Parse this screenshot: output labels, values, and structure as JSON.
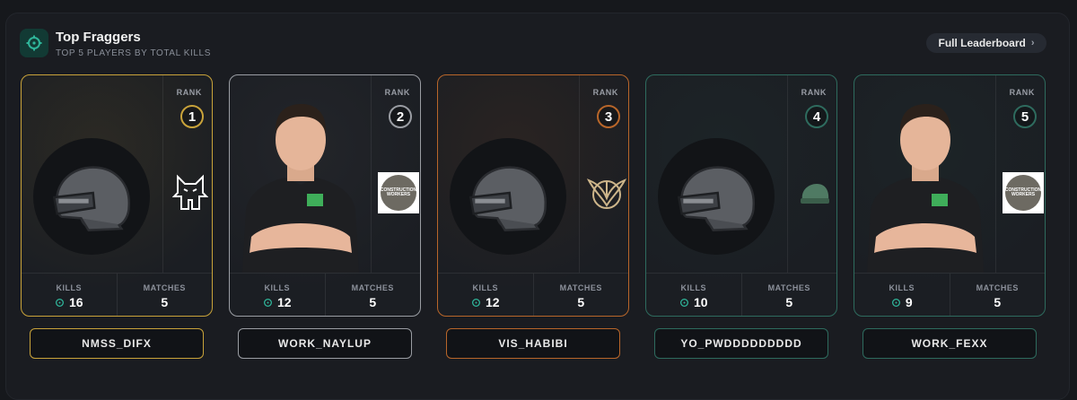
{
  "header": {
    "title": "Top Fraggers",
    "subtitle": "TOP 5 PLAYERS BY TOTAL KILLS",
    "leaderboard_button": "Full Leaderboard"
  },
  "labels": {
    "rank": "RANK",
    "kills": "KILLS",
    "matches": "MATCHES"
  },
  "players": [
    {
      "rank": "1",
      "name": "NMSS_DIFX",
      "kills": "16",
      "matches": "5",
      "accent": "#c9a33a"
    },
    {
      "rank": "2",
      "name": "WORK_NAYLUP",
      "kills": "12",
      "matches": "5",
      "accent": "#9a9da3"
    },
    {
      "rank": "3",
      "name": "VIS_HABIBI",
      "kills": "12",
      "matches": "5",
      "accent": "#b8662a"
    },
    {
      "rank": "4",
      "name": "YO_PWDDDDDDDDD",
      "kills": "10",
      "matches": "5",
      "accent": "#2e6b5e"
    },
    {
      "rank": "5",
      "name": "WORK_FEXX",
      "kills": "9",
      "matches": "5",
      "accent": "#2e6b5e"
    }
  ],
  "team_logos": {
    "construction_workers": "CONSTRUCTION WORKERS"
  },
  "colors": {
    "teal": "#2fb59a",
    "gold": "#c9a33a",
    "silver": "#9a9da3",
    "bronze": "#b8662a",
    "green": "#2e6b5e"
  }
}
